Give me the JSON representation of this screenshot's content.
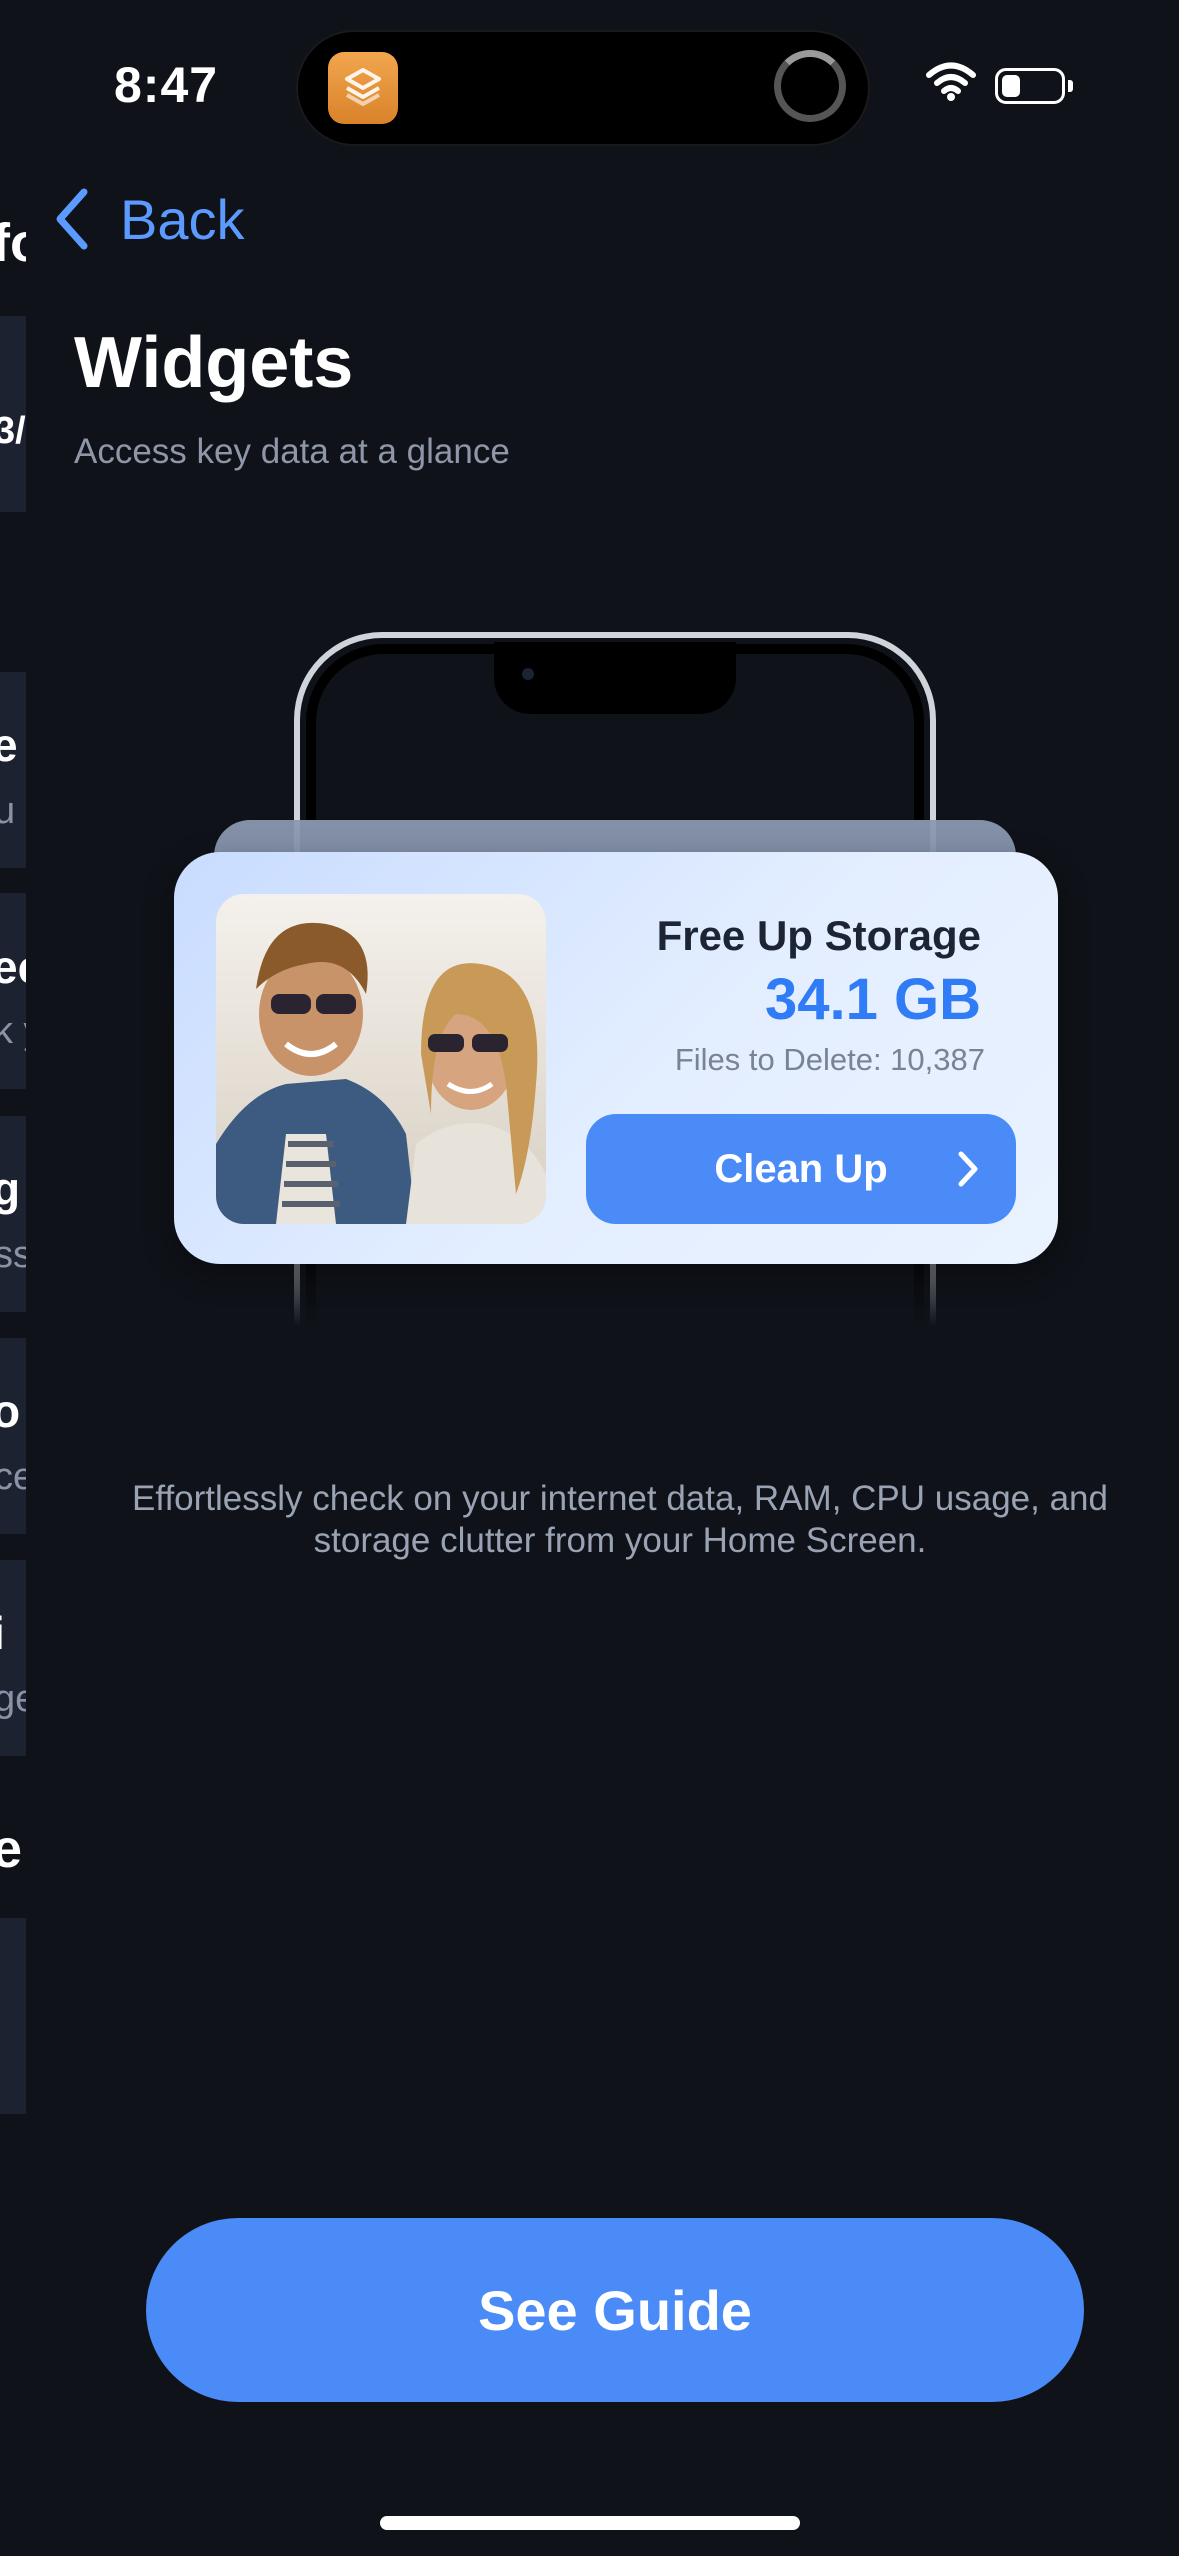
{
  "status_bar": {
    "time": "8:47",
    "icons": [
      "shortcuts-app-icon",
      "activity-spinner-icon",
      "wifi-icon",
      "battery-icon"
    ]
  },
  "background_sheet": {
    "peek_texts": [
      "fo",
      "3/",
      "e",
      "u",
      "ec",
      "k y",
      "g",
      "ss",
      "o",
      "ce",
      "i",
      "ge",
      "e"
    ]
  },
  "nav": {
    "back_label": "Back"
  },
  "header": {
    "title": "Widgets",
    "subtitle": "Access key data at a glance"
  },
  "widget": {
    "title": "Free Up Storage",
    "size": "34.1 GB",
    "files_label": "Files to Delete: 10,387",
    "button_label": "Clean Up",
    "accent_color": "#2f7cf6"
  },
  "description": "Effortlessly check on your internet data, RAM, CPU usage, and storage clutter from your Home Screen.",
  "cta": {
    "label": "See Guide"
  },
  "colors": {
    "background": "#0f1218",
    "primary": "#4a8bf7",
    "link": "#5b9bff"
  }
}
